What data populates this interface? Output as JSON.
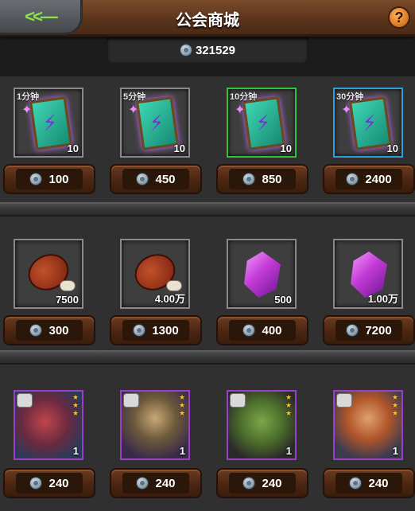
{
  "header": {
    "title": "公会商城",
    "back_glyph": "<<—",
    "help_glyph": "?"
  },
  "currency": {
    "amount": "321529",
    "icon": "guild-coin-icon"
  },
  "rows": [
    {
      "items": [
        {
          "tag": "1分钟",
          "qty": "10",
          "price": "100",
          "art": "speed-book-icon",
          "rarity": "white"
        },
        {
          "tag": "5分钟",
          "qty": "10",
          "price": "450",
          "art": "speed-book-icon",
          "rarity": "white"
        },
        {
          "tag": "10分钟",
          "qty": "10",
          "price": "850",
          "art": "speed-book-icon",
          "rarity": "green"
        },
        {
          "tag": "30分钟",
          "qty": "10",
          "price": "2400",
          "art": "speed-book-icon",
          "rarity": "blue"
        }
      ]
    },
    {
      "items": [
        {
          "tag": "",
          "qty": "7500",
          "price": "300",
          "art": "meat-icon",
          "rarity": "white"
        },
        {
          "tag": "",
          "qty": "4.00万",
          "price": "1300",
          "art": "meat-icon",
          "rarity": "white"
        },
        {
          "tag": "",
          "qty": "500",
          "price": "400",
          "art": "crystal-icon",
          "rarity": "white"
        },
        {
          "tag": "",
          "qty": "1.00万",
          "price": "7200",
          "art": "crystal-icon",
          "rarity": "white"
        }
      ]
    },
    {
      "items": [
        {
          "tag": "",
          "qty": "1",
          "price": "240",
          "art": "hero-fragment-icon",
          "rarity": "purple",
          "stars": 3
        },
        {
          "tag": "",
          "qty": "1",
          "price": "240",
          "art": "hero-fragment-icon",
          "rarity": "purple",
          "stars": 3
        },
        {
          "tag": "",
          "qty": "1",
          "price": "240",
          "art": "hero-fragment-icon",
          "rarity": "purple",
          "stars": 3
        },
        {
          "tag": "",
          "qty": "1",
          "price": "240",
          "art": "hero-fragment-icon",
          "rarity": "purple",
          "stars": 3
        }
      ]
    }
  ]
}
